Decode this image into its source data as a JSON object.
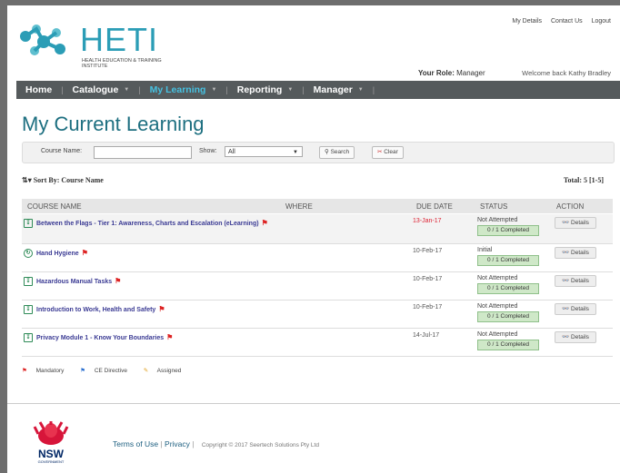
{
  "header": {
    "logo_title": "HETI",
    "logo_sub": "HEALTH EDUCATION & TRAINING INSTITUTE",
    "top_links": [
      "My Details",
      "Contact Us",
      "Logout"
    ],
    "role_label": "Your Role:",
    "role_value": "Manager",
    "welcome": "Welcome back Kathy Bradley"
  },
  "nav": [
    {
      "label": "Home",
      "dropdown": false
    },
    {
      "label": "Catalogue",
      "dropdown": true
    },
    {
      "label": "My Learning",
      "dropdown": true,
      "active": true
    },
    {
      "label": "Reporting",
      "dropdown": true
    },
    {
      "label": "Manager",
      "dropdown": true
    }
  ],
  "page_title": "My Current Learning",
  "filter": {
    "course_label": "Course Name:",
    "course_value": "",
    "show_label": "Show:",
    "show_value": "All",
    "search_button": "Search",
    "clear_button": "Clear"
  },
  "sort_label": "Sort By: Course Name",
  "total": "Total: 5 [1-5]",
  "table": {
    "headers": [
      "COURSE NAME",
      "WHERE",
      "DUE DATE",
      "STATUS",
      "ACTION"
    ],
    "rows": [
      {
        "name": "Between the Flags - Tier 1: Awareness, Charts and Escalation (eLearning)",
        "due": "13-Jan-17",
        "late": true,
        "status": "Not Attempted",
        "progress": "0 / 1 Completed",
        "action": "Details"
      },
      {
        "name": "Hand Hygiene",
        "due": "10-Feb-17",
        "late": false,
        "status": "Initial",
        "progress": "0 / 1 Completed",
        "action": "Details"
      },
      {
        "name": "Hazardous Manual Tasks",
        "due": "10-Feb-17",
        "late": false,
        "status": "Not Attempted",
        "progress": "0 / 1 Completed",
        "action": "Details"
      },
      {
        "name": "Introduction to Work, Health and Safety",
        "due": "10-Feb-17",
        "late": false,
        "status": "Not Attempted",
        "progress": "0 / 1 Completed",
        "action": "Details"
      },
      {
        "name": "Privacy Module 1 - Know Your Boundaries",
        "due": "14-Jul-17",
        "late": false,
        "status": "Not Attempted",
        "progress": "0 / 1 Completed",
        "action": "Details"
      }
    ]
  },
  "legend": [
    "Mandatory",
    "CE Directive",
    "Assigned"
  ],
  "footer": {
    "terms": "Terms of Use",
    "privacy": "Privacy",
    "copyright": "Copyright © 2017 Seertech Solutions Pty Ltd",
    "nsw_label": "NSW",
    "nsw_sub": "GOVERNMENT"
  },
  "colors": {
    "nav_bg": "#555a5c",
    "nav_active": "#46c0e0",
    "title": "#1d6f80",
    "link": "#3b3b94",
    "late": "#d22233"
  }
}
